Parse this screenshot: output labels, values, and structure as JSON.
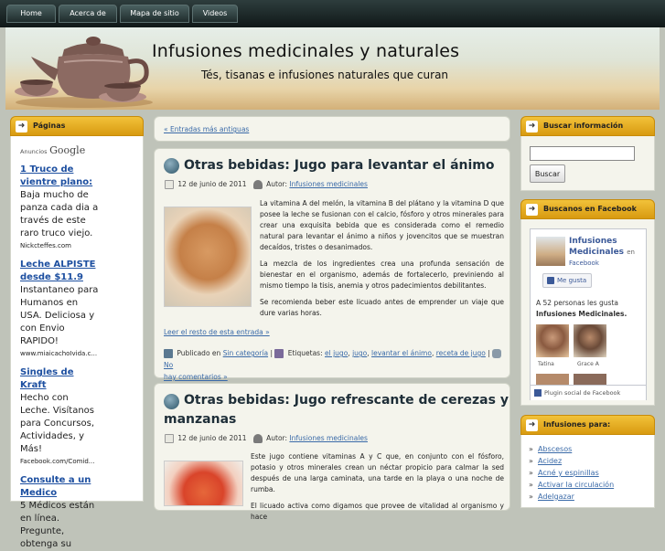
{
  "nav": {
    "items": [
      "Home",
      "Acerca de",
      "Mapa de sitio",
      "Videos"
    ]
  },
  "header": {
    "title": "Infusiones medicinales y naturales",
    "tagline": "Tés, tisanas e infusiones naturales que curan"
  },
  "left_sidebar": {
    "title": "Páginas",
    "ads_label": "Anuncios",
    "ads_brand": "Google",
    "ads": [
      {
        "title": "1 Truco de vientre plano:",
        "text": "Baja mucho de panza cada dia a través de este raro truco viejo.",
        "url": "Nickcteffes.com"
      },
      {
        "title": "Leche ALPISTE desde $11.9",
        "text": "Instantaneo para Humanos en USA. Deliciosa y con Envio RAPIDO!",
        "url": "www.miaicachoIvida.c..."
      },
      {
        "title": "Singles de Kraft",
        "text": "Hecho con Leche. Visítanos para Concursos, Actividades, y Más!",
        "url": "Facebook.com/Comid..."
      },
      {
        "title": "Consulte a un Medico",
        "text": "5 Médicos están en línea. Pregunte, obtenga su",
        "url": ""
      }
    ]
  },
  "main": {
    "older_link": "« Entradas más antiguas",
    "posts": [
      {
        "title": "Otras bebidas: Jugo para levantar el ánimo",
        "date": "12 de junio de 2011",
        "author_label": "Autor:",
        "author": "Infusiones medicinales",
        "paragraphs": [
          "La vitamina A del melón, la vitamina B del plátano y la vitamina D que posee la leche se fusionan con el calcio, fósforo y otros minerales para crear una exquisita bebida que es considerada como el remedio natural para levantar el ánimo a niños y jovencitos que se muestran decaídos, tristes o desanimados.",
          "La mezcla de los ingredientes crea una profunda sensación de bienestar en el organismo, además de fortalecerlo, previniendo al mismo tiempo la tisis, anemia y otros padecimientos debilitantes.",
          "Se recomienda beber este licuado antes de emprender un viaje que dure varias horas."
        ],
        "read_more": "Leer el resto de esta entrada »",
        "published_label": "Publicado en",
        "category": "Sin categoría",
        "tags_label": "Etiquetas:",
        "tags": [
          "el jugo",
          "jugo",
          "levantar el ánimo",
          "receta de jugo"
        ],
        "comments_a": "No",
        "comments_b": "hay comentarios »"
      },
      {
        "title_line1": "Otras bebidas: Jugo refrescante de cerezas y",
        "title_line2": "manzanas",
        "date": "12 de junio de 2011",
        "author_label": "Autor:",
        "author": "Infusiones medicinales",
        "paragraphs": [
          "Este jugo contiene vitaminas A y C que, en conjunto con el fósforo, potasio y otros minerales crean un néctar propicio para calmar la sed después de una larga caminata, una tarde en la playa o una noche de rumba.",
          "El licuado activa como digamos que provee de vitalidad al organismo y hace"
        ]
      }
    ]
  },
  "right_sidebar": {
    "search": {
      "title": "Buscar información",
      "button": "Buscar",
      "value": ""
    },
    "facebook": {
      "title": "Buscanos en Facebook",
      "page_name": "Infusiones Medicinales",
      "en": "en",
      "site": "Facebook",
      "like": "Me gusta",
      "likes_text": "A 52 personas les gusta",
      "likes_page": "Infusiones Medicinales.",
      "fans": [
        "Tatina",
        "Grace A"
      ],
      "plugin": "Plugin social de Facebook"
    },
    "infusiones": {
      "title": "Infusiones para:",
      "items": [
        "Abscesos",
        "Acidez",
        "Acné y espinillas",
        "Activar la circulación",
        "Adelgazar"
      ]
    }
  }
}
